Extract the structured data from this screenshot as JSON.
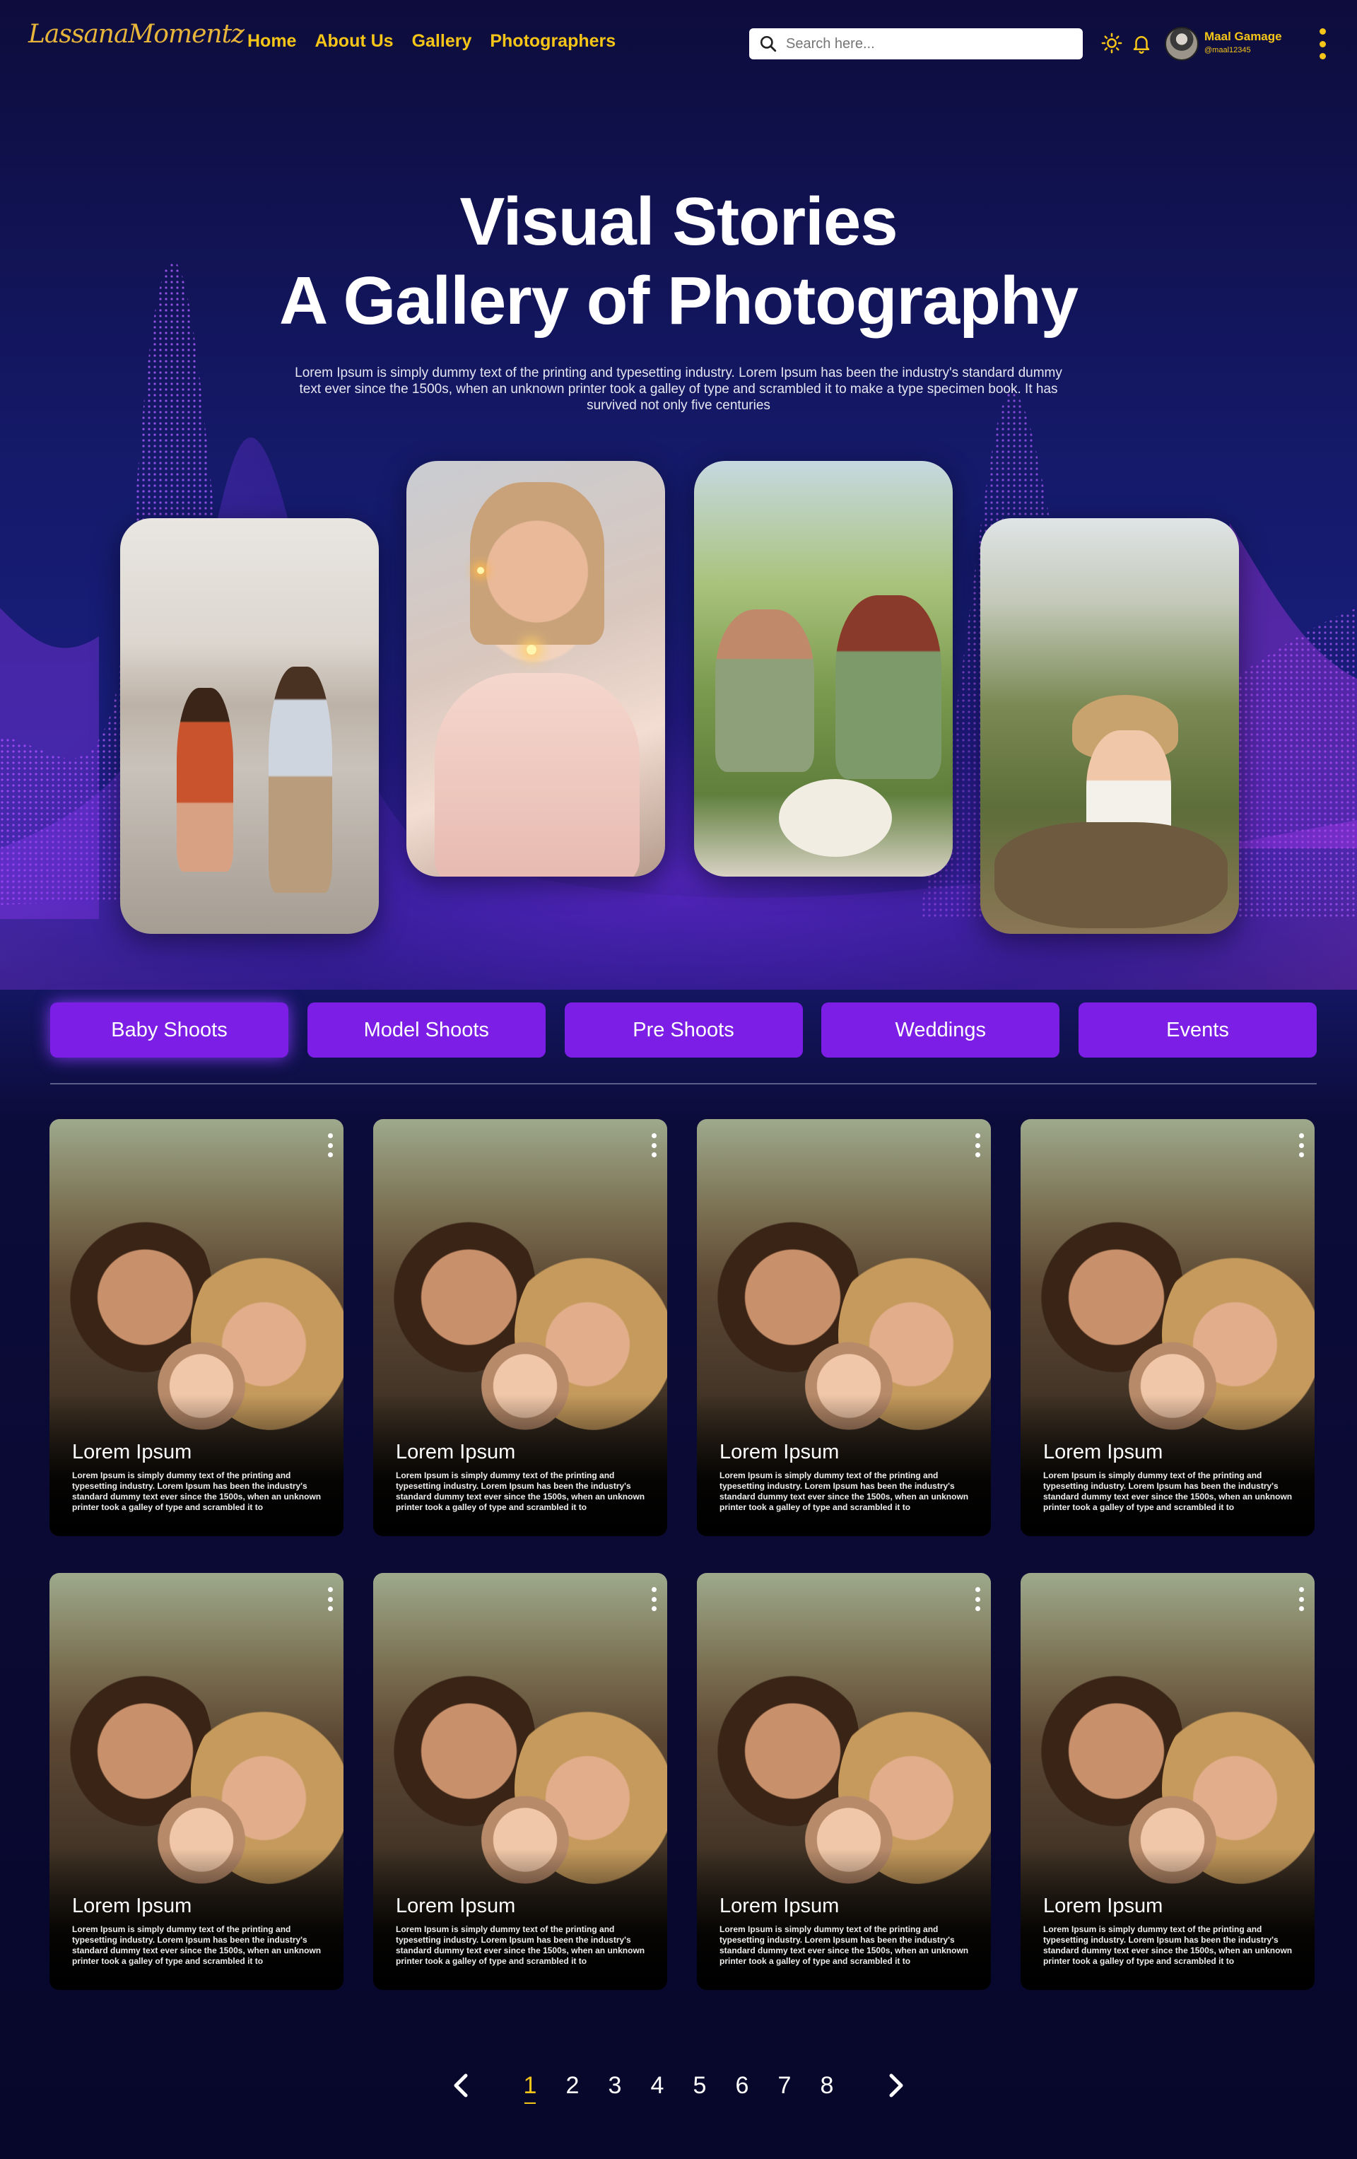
{
  "brand": {
    "logo_text": "LassanaMomentz"
  },
  "nav": [
    "Home",
    "About Us",
    "Gallery",
    "Photographers"
  ],
  "search": {
    "placeholder": "Search here..."
  },
  "user": {
    "name": "Maal Gamage",
    "handle": "@maal12345"
  },
  "hero": {
    "title_line1": "Visual Stories",
    "title_line2": "A Gallery of Photography",
    "description": "Lorem Ipsum is simply dummy text of the printing and typesetting industry. Lorem Ipsum has been the industry's standard dummy text ever since the 1500s, when an unknown printer took a galley of type and scrambled it to make a type specimen book. It has survived not only five centuries"
  },
  "categories": [
    "Baby Shoots",
    "Model Shoots",
    "Pre Shoots",
    "Weddings",
    "Events"
  ],
  "cards": [
    {
      "title": "Lorem Ipsum",
      "description": "Lorem Ipsum is simply dummy text of the printing and typesetting industry. Lorem Ipsum has been the industry's standard dummy text ever since the 1500s, when an unknown printer took a galley of type and scrambled it to"
    },
    {
      "title": "Lorem Ipsum",
      "description": "Lorem Ipsum is simply dummy text of the printing and typesetting industry. Lorem Ipsum has been the industry's standard dummy text ever since the 1500s, when an unknown printer took a galley of type and scrambled it to"
    },
    {
      "title": "Lorem Ipsum",
      "description": "Lorem Ipsum is simply dummy text of the printing and typesetting industry. Lorem Ipsum has been the industry's standard dummy text ever since the 1500s, when an unknown printer took a galley of type and scrambled it to"
    },
    {
      "title": "Lorem Ipsum",
      "description": "Lorem Ipsum is simply dummy text of the printing and typesetting industry. Lorem Ipsum has been the industry's standard dummy text ever since the 1500s, when an unknown printer took a galley of type and scrambled it to"
    },
    {
      "title": "Lorem Ipsum",
      "description": "Lorem Ipsum is simply dummy text of the printing and typesetting industry. Lorem Ipsum has been the industry's standard dummy text ever since the 1500s, when an unknown printer took a galley of type and scrambled it to"
    },
    {
      "title": "Lorem Ipsum",
      "description": "Lorem Ipsum is simply dummy text of the printing and typesetting industry. Lorem Ipsum has been the industry's standard dummy text ever since the 1500s, when an unknown printer took a galley of type and scrambled it to"
    },
    {
      "title": "Lorem Ipsum",
      "description": "Lorem Ipsum is simply dummy text of the printing and typesetting industry. Lorem Ipsum has been the industry's standard dummy text ever since the 1500s, when an unknown printer took a galley of type and scrambled it to"
    },
    {
      "title": "Lorem Ipsum",
      "description": "Lorem Ipsum is simply dummy text of the printing and typesetting industry. Lorem Ipsum has been the industry's standard dummy text ever since the 1500s, when an unknown printer took a galley of type and scrambled it to"
    }
  ],
  "pagination": {
    "pages": [
      "1",
      "2",
      "3",
      "4",
      "5",
      "6",
      "7",
      "8"
    ],
    "current": "1"
  },
  "icons": {
    "search": "search-icon",
    "theme": "sun-icon",
    "notifications": "bell-icon",
    "menu": "more-vertical-icon",
    "prev": "chevron-left-icon",
    "next": "chevron-right-icon"
  },
  "colors": {
    "accent": "#f5c518",
    "category_button": "#7c1ee6",
    "background": "#0d0c3c"
  }
}
